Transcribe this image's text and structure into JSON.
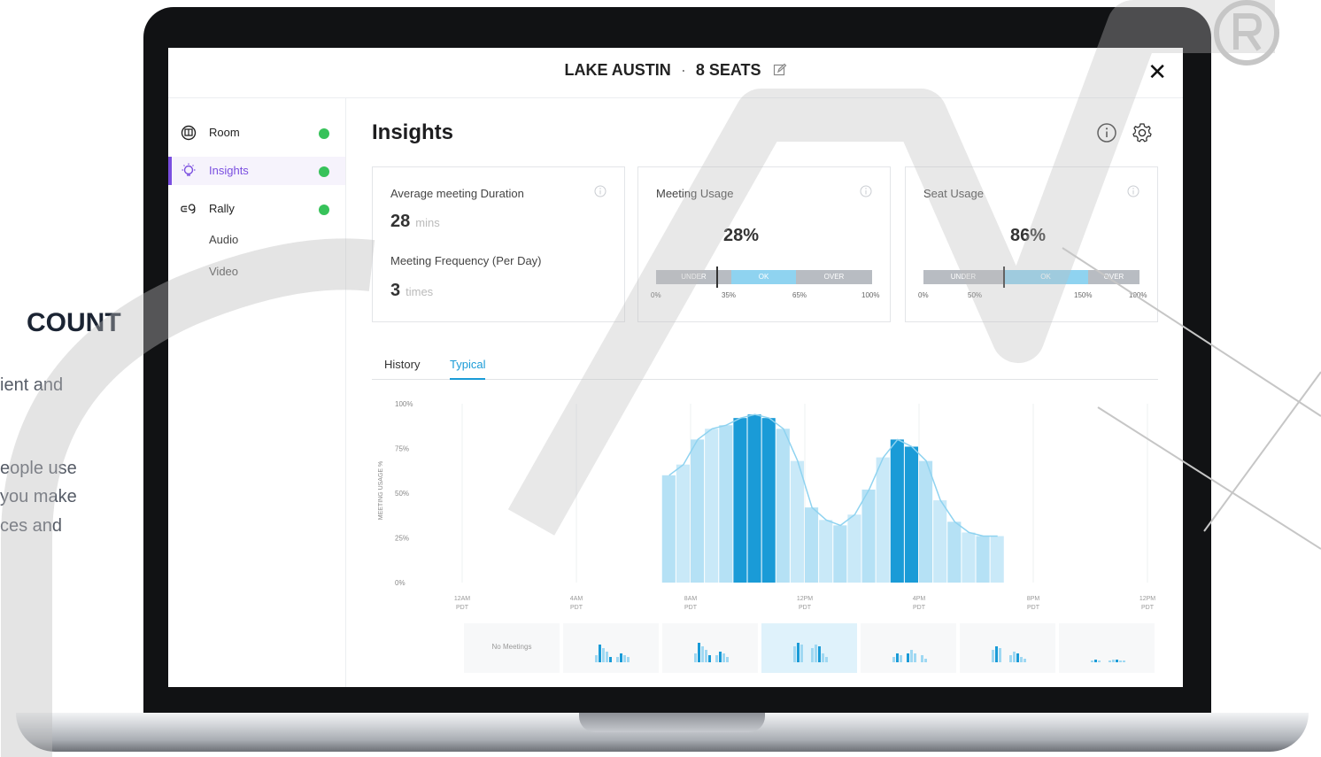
{
  "background": {
    "heading": "COUNT",
    "lines": [
      "ient and",
      "eople use",
      "you make",
      "ces and"
    ]
  },
  "header": {
    "room_name": "LAKE AUSTIN",
    "separator": "·",
    "seats": "8 SEATS",
    "edit_icon": "pencil-edit-icon",
    "close_label": "✕"
  },
  "sidebar": {
    "items": [
      {
        "label": "Room",
        "icon": "room-icon",
        "status_color": "#37c25a"
      },
      {
        "label": "Insights",
        "icon": "lightbulb-icon",
        "status_color": "#37c25a"
      },
      {
        "label": "Rally",
        "icon": "rally-camera-icon",
        "status_color": "#37c25a"
      }
    ],
    "sub_items": [
      "Audio",
      "Video"
    ]
  },
  "main": {
    "title": "Insights",
    "header_icons": [
      "info-icon",
      "gear-icon"
    ],
    "cards": {
      "duration": {
        "title": "Average meeting Duration",
        "value": "28",
        "unit": "mins",
        "freq_title": "Meeting Frequency (Per Day)",
        "freq_value": "3",
        "freq_unit": "times"
      },
      "meeting_usage": {
        "title": "Meeting Usage",
        "value_text": "28%",
        "value": 0.28,
        "segments": [
          "UNDER",
          "OK",
          "OVER"
        ],
        "ticks": [
          "0%",
          "35%",
          "65%",
          "100%"
        ]
      },
      "seat_usage": {
        "title": "Seat Usage",
        "value_text": "86%",
        "value": 0.86,
        "segments": [
          "UNDER",
          "OK",
          "OVER"
        ],
        "ticks": [
          "0%",
          "50%",
          "150%",
          "100%"
        ]
      }
    },
    "tabs": [
      "History",
      "Typical"
    ],
    "active_tab": "Typical",
    "thumbnail_no_meetings": "No Meetings"
  },
  "colors": {
    "accent_purple": "#7a4ee0",
    "status_green": "#37c25a",
    "bar_blue": "#1a9bd7",
    "gauge_ok": "#8fd3f0",
    "gauge_grey": "#b8bcc2"
  },
  "chart_data": {
    "type": "area",
    "ylabel": "MEETING USAGE %",
    "yticks": [
      "100%",
      "75%",
      "50%",
      "25%",
      "0%"
    ],
    "xticks": [
      [
        "12AM",
        "PDT"
      ],
      [
        "4AM",
        "PDT"
      ],
      [
        "8AM",
        "PDT"
      ],
      [
        "12PM",
        "PDT"
      ],
      [
        "4PM",
        "PDT"
      ],
      [
        "8PM",
        "PDT"
      ],
      [
        "12PM",
        "PDT"
      ]
    ],
    "ylim": [
      0,
      100
    ],
    "xlim": [
      0,
      24
    ],
    "x": [
      7.0,
      7.5,
      8.0,
      8.5,
      9.0,
      9.5,
      10.0,
      10.5,
      11.0,
      11.5,
      12.0,
      12.5,
      13.0,
      13.5,
      14.0,
      14.5,
      15.0,
      15.5,
      16.0,
      16.5,
      17.0,
      17.5,
      18.0,
      18.5
    ],
    "values": [
      60,
      66,
      80,
      86,
      88,
      92,
      94,
      92,
      86,
      68,
      42,
      35,
      32,
      38,
      52,
      70,
      80,
      76,
      68,
      46,
      34,
      28,
      26,
      26
    ],
    "highlight": [
      [
        9.5,
        11.0
      ],
      [
        15.0,
        16.0
      ]
    ],
    "grid": true
  }
}
